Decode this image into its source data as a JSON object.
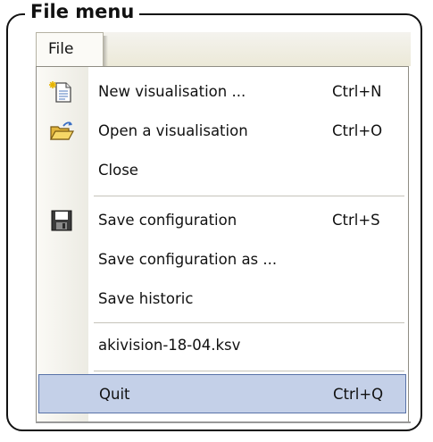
{
  "caption": "File menu",
  "menubar": {
    "file_label": "File"
  },
  "menu": {
    "items": [
      {
        "label": "New visualisation ...",
        "shortcut": "Ctrl+N",
        "icon": "new-document-icon"
      },
      {
        "label": "Open a visualisation",
        "shortcut": "Ctrl+O",
        "icon": "open-folder-icon"
      },
      {
        "label": "Close",
        "shortcut": ""
      },
      {
        "label": "Save configuration",
        "shortcut": "Ctrl+S",
        "icon": "floppy-disk-icon"
      },
      {
        "label": "Save configuration as ...",
        "shortcut": ""
      },
      {
        "label": "Save historic",
        "shortcut": ""
      },
      {
        "label": "akivision-18-04.ksv",
        "shortcut": ""
      },
      {
        "label": "Quit",
        "shortcut": "Ctrl+Q"
      }
    ]
  },
  "colors": {
    "highlight_fill": "#c4d0e8",
    "highlight_border": "#5973a8",
    "menubar": "#ece9d8"
  }
}
